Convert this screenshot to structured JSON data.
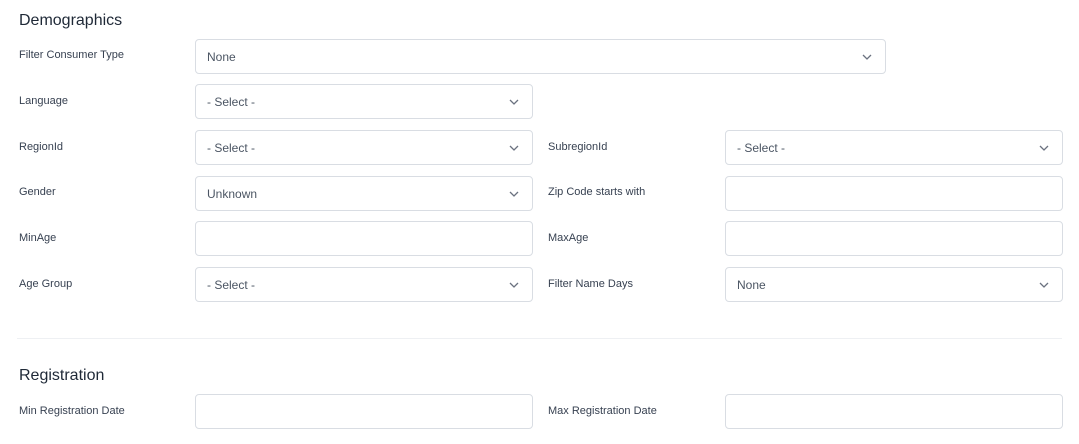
{
  "demographics": {
    "title": "Demographics",
    "filter_consumer_type": {
      "label": "Filter Consumer Type",
      "value": "None"
    },
    "language": {
      "label": "Language",
      "value": "- Select -"
    },
    "region_id": {
      "label": "RegionId",
      "value": "- Select -"
    },
    "subregion_id": {
      "label": "SubregionId",
      "value": "- Select -"
    },
    "gender": {
      "label": "Gender",
      "value": "Unknown"
    },
    "zip_code": {
      "label": "Zip Code starts with",
      "value": ""
    },
    "min_age": {
      "label": "MinAge",
      "value": ""
    },
    "max_age": {
      "label": "MaxAge",
      "value": ""
    },
    "age_group": {
      "label": "Age Group",
      "value": "- Select -"
    },
    "filter_name_days": {
      "label": "Filter Name Days",
      "value": "None"
    }
  },
  "registration": {
    "title": "Registration",
    "min_registration_date": {
      "label": "Min Registration Date",
      "value": ""
    },
    "max_registration_date": {
      "label": "Max Registration Date",
      "value": ""
    }
  },
  "icons": {
    "select_arrow": "chevron-down-icon"
  },
  "colors": {
    "border": "#d9dde3",
    "text": "#1f2937",
    "muted_text": "#4b5563",
    "chevron": "#6b7280"
  }
}
